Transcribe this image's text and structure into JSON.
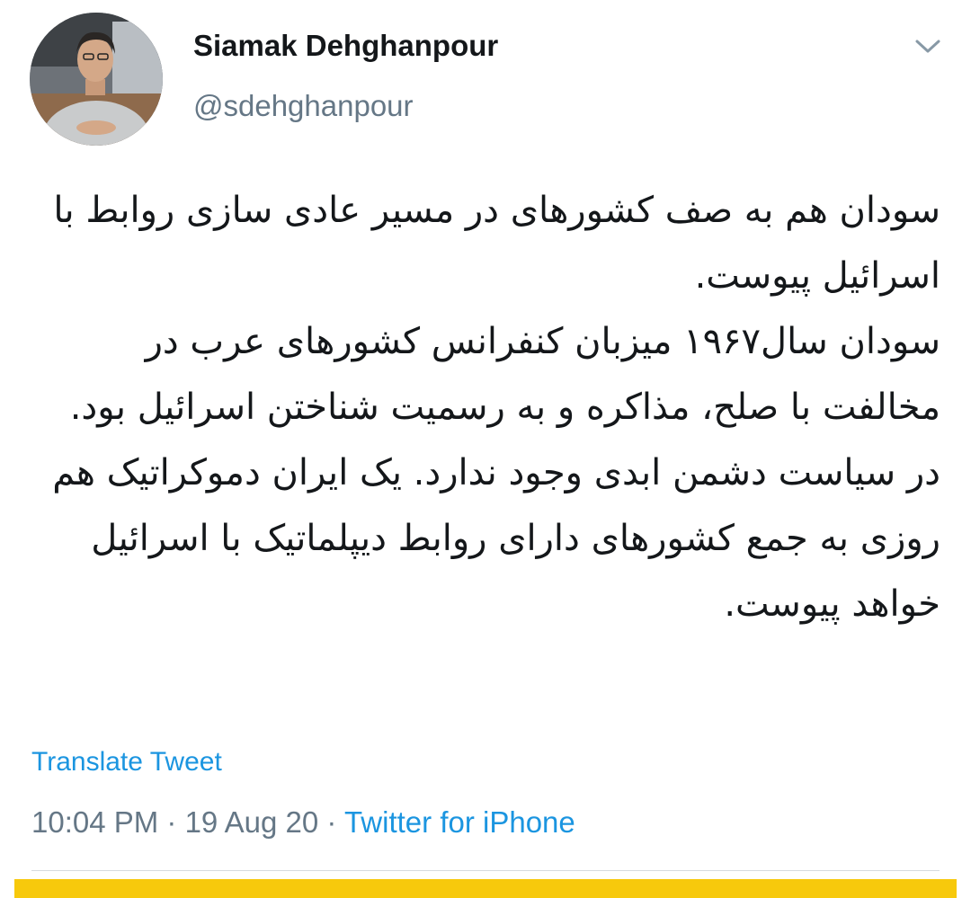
{
  "author": {
    "display_name": "Siamak Dehghanpour",
    "handle": "@sdehghanpour"
  },
  "tweet": {
    "paragraphs": [
      "سودان هم به صف کشورهای در مسیر عادی سازی روابط با اسرائیل پیوست.",
      "سودان سال۱۹۶۷ میزبان کنفرانس کشورهای عرب در مخالفت با صلح، مذاکره و به رسمیت شناختن اسرائیل بود.",
      "در سیاست دشمن ابدی وجود ندارد. یک ایران دموکراتیک هم روزی به جمع کشورهای دارای روابط دیپلماتیک با اسرائیل خواهد پیوست."
    ]
  },
  "actions": {
    "translate_label": "Translate Tweet"
  },
  "meta": {
    "time": "10:04 PM",
    "date": "19 Aug 20",
    "separator": " · ",
    "source": "Twitter for iPhone"
  },
  "icons": {
    "more": "chevron-down-icon",
    "avatar": "avatar"
  },
  "colors": {
    "link": "#1b95e0",
    "secondary_text": "#657786",
    "primary_text": "#14171a",
    "bottom_bar": "#f7c90c"
  }
}
